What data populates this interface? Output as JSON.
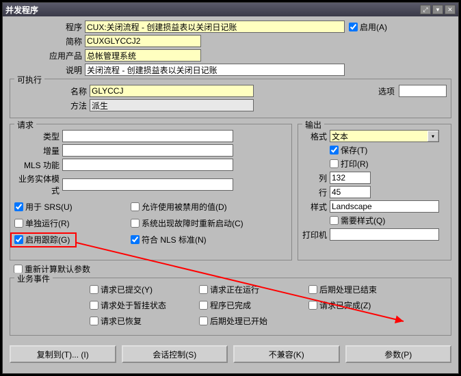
{
  "titlebar": {
    "title": "并发程序"
  },
  "top": {
    "program_label": "程序",
    "program_value": "CUX:关闭流程 - 创建损益表以关闭日记账",
    "enable_label": "启用(A)",
    "short_label": "简称",
    "short_value": "CUXGLYCCJ2",
    "app_label": "应用产品",
    "app_value": "总帐管理系统",
    "desc_label": "说明",
    "desc_value": "关闭流程 - 创建损益表以关闭日记账"
  },
  "exec": {
    "legend": "可执行",
    "name_label": "名称",
    "name_value": "GLYCCJ",
    "options_label": "选项",
    "method_label": "方法",
    "method_value": "派生"
  },
  "request": {
    "legend": "请求",
    "type_label": "类型",
    "incr_label": "增量",
    "mls_label": "MLS 功能",
    "entity_label": "业务实体模式",
    "srs": "用于 SRS(U)",
    "alone": "单独运行(R)",
    "trace": "启用跟踪(G)",
    "recalc": "重新计算默认参数",
    "allow": "允许使用被禁用的值(D)",
    "restart": "系统出现故障时重新启动(C)",
    "nls": "符合 NLS 标准(N)"
  },
  "output": {
    "legend": "输出",
    "format_label": "格式",
    "format_value": "文本",
    "save": "保存(T)",
    "print": "打印(R)",
    "col_label": "列",
    "col_value": "132",
    "row_label": "行",
    "row_value": "45",
    "style_label": "样式",
    "style_value": "Landscape",
    "need_style": "需要样式(Q)",
    "printer_label": "打印机"
  },
  "biz": {
    "legend": "业务事件",
    "submitted": "请求已提交(Y)",
    "running": "请求正在运行",
    "post_done": "后期处理已结束",
    "paused": "请求处于暂挂状态",
    "prog_done": "程序已完成",
    "req_done": "请求已完成(Z)",
    "resumed": "请求已恢复",
    "post_start": "后期处理已开始"
  },
  "buttons": {
    "copy": "复制到(T)... (I)",
    "session": "会话控制(S)",
    "incompat": "不兼容(K)",
    "params": "参数(P)"
  }
}
